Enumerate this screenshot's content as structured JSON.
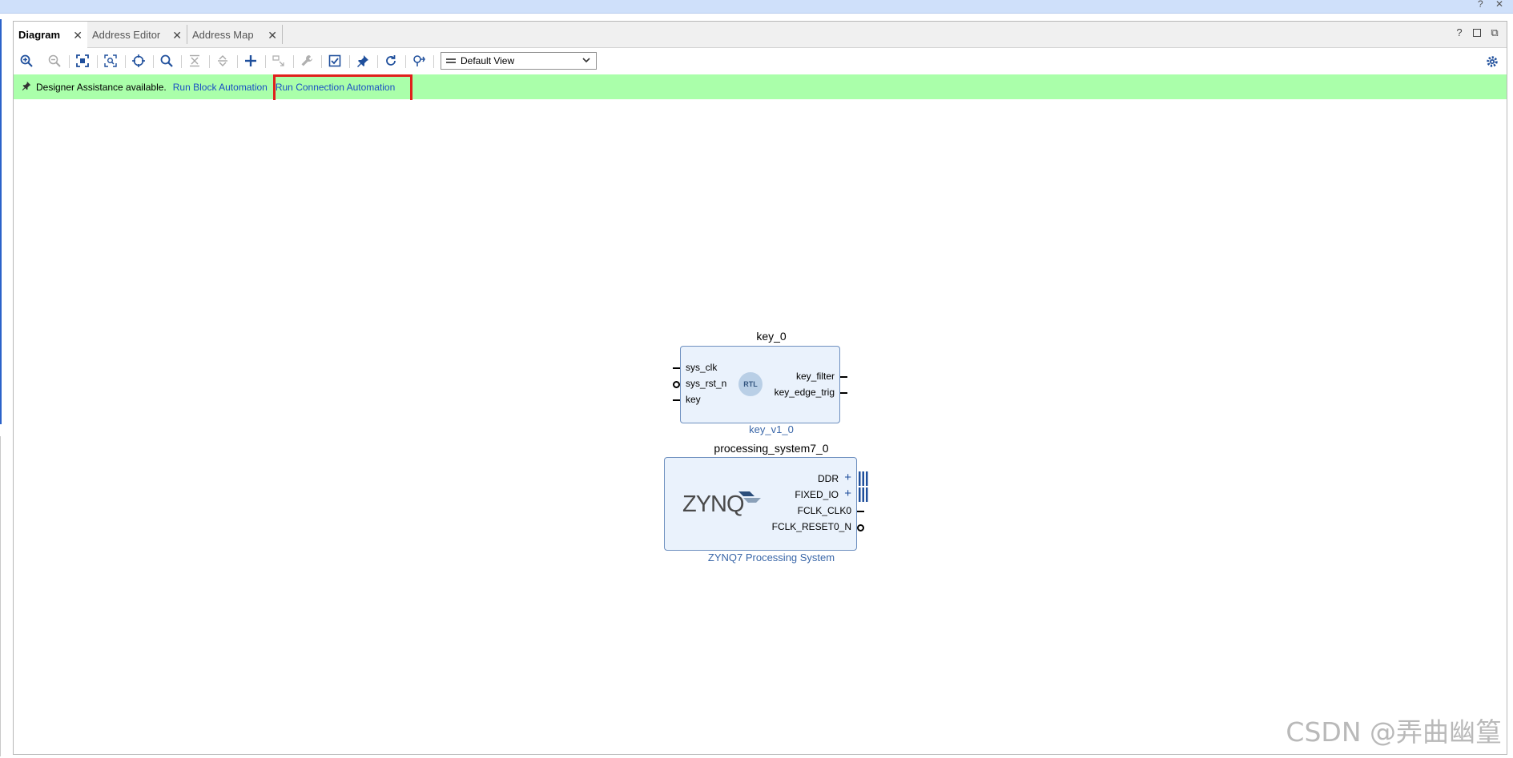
{
  "window": {
    "controls": "? ✕"
  },
  "tabs": [
    {
      "label": "Diagram",
      "active": true
    },
    {
      "label": "Address Editor",
      "active": false
    },
    {
      "label": "Address Map",
      "active": false
    }
  ],
  "toolbar": {
    "icons": [
      "zoom-in-icon",
      "zoom-out-icon",
      "zoom-fit-icon",
      "zoom-area-icon",
      "center-icon",
      "search-icon",
      "collapse-all-icon",
      "expand-all-icon",
      "add-ip-icon",
      "add-module-icon",
      "wrench-icon",
      "validate-icon",
      "pin-icon",
      "regenerate-icon",
      "optimize-routing-icon"
    ],
    "view_select": "Default View"
  },
  "assistance": {
    "text": "Designer Assistance available.",
    "link_block": "Run Block Automation",
    "link_connection": "Run Connection Automation"
  },
  "blocks": {
    "key": {
      "instance": "key_0",
      "module": "key_v1_0",
      "icon": "RTL",
      "inputs": [
        "sys_clk",
        "sys_rst_n",
        "key"
      ],
      "outputs": [
        "key_filter",
        "key_edge_trig"
      ]
    },
    "ps": {
      "instance": "processing_system7_0",
      "module": "ZYNQ7 Processing System",
      "logo": "ZYNQ",
      "outputs": [
        "DDR",
        "FIXED_IO",
        "FCLK_CLK0",
        "FCLK_RESET0_N"
      ]
    }
  },
  "watermark": "CSDN @弄曲幽篁",
  "colors": {
    "assist_bg": "#aaffaa",
    "link": "#1a4ec4",
    "highlight": "#e0201c",
    "block_fill": "#eaf2fc"
  }
}
